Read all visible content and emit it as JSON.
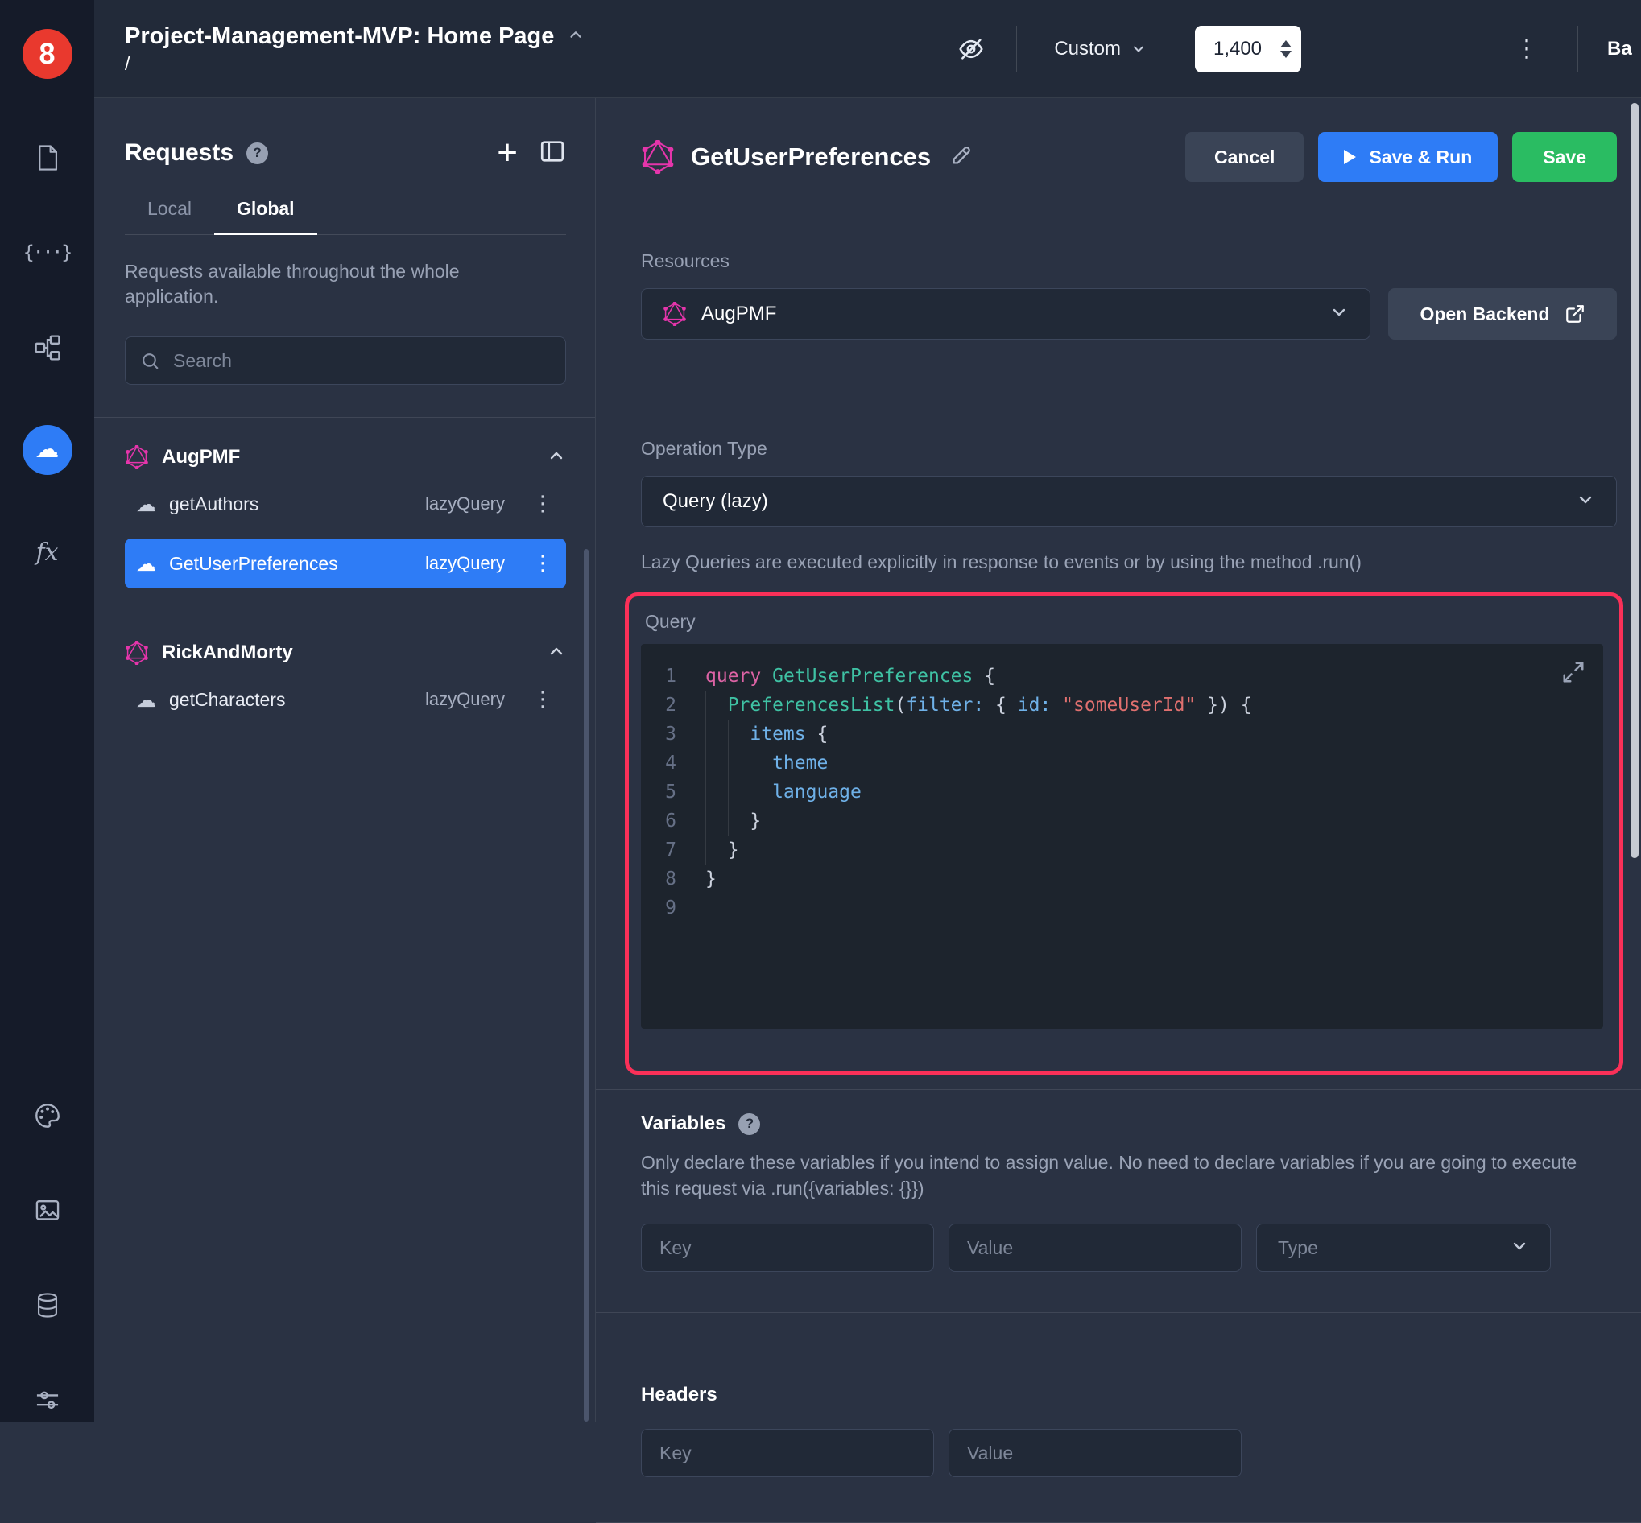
{
  "colors": {
    "accent_blue": "#2e7cf6",
    "save_green": "#2abc62",
    "annotation_pink": "#fa3058",
    "graphql_pink": "#e535ab"
  },
  "icons": {
    "cloud": "☁",
    "kebab": "⋮",
    "plus": "+",
    "help": "?",
    "braces": "{···}",
    "fx": "fx",
    "logo": "8"
  },
  "topbar": {
    "title": "Project-Management-MVP: Home Page",
    "path": "/",
    "breakpoint": "Custom",
    "canvas_width": "1,400",
    "clipped_right_text": "Ba"
  },
  "requests": {
    "title": "Requests",
    "tabs": {
      "local": "Local",
      "global": "Global"
    },
    "description": "Requests available throughout the whole application.",
    "search_placeholder": "Search",
    "groups": [
      {
        "name": "AugPMF",
        "items": [
          {
            "name": "getAuthors",
            "kind": "lazyQuery"
          },
          {
            "name": "GetUserPreferences",
            "kind": "lazyQuery"
          }
        ]
      },
      {
        "name": "RickAndMorty",
        "items": [
          {
            "name": "getCharacters",
            "kind": "lazyQuery"
          }
        ]
      }
    ]
  },
  "main": {
    "title": "GetUserPreferences",
    "buttons": {
      "cancel": "Cancel",
      "save_run": "Save & Run",
      "save": "Save"
    },
    "resources": {
      "label": "Resources",
      "value": "AugPMF",
      "open_backend": "Open Backend"
    },
    "operation": {
      "label": "Operation Type",
      "value": "Query (lazy)",
      "hint": "Lazy Queries are executed explicitly in response to events or by using the method .run()"
    },
    "query": {
      "label": "Query",
      "lines": [
        {
          "n": "1",
          "tokens": [
            [
              "kw",
              "query"
            ],
            [
              "p",
              " "
            ],
            [
              "ty",
              "GetUserPreferences"
            ],
            [
              "p",
              " {"
            ]
          ]
        },
        {
          "n": "2",
          "tokens": [
            [
              "ind",
              "  "
            ],
            [
              "ty",
              "PreferencesList"
            ],
            [
              "p",
              "("
            ],
            [
              "fld",
              "filter:"
            ],
            [
              "p",
              " { "
            ],
            [
              "fld",
              "id:"
            ],
            [
              "p",
              " "
            ],
            [
              "str",
              "\"someUserId\""
            ],
            [
              "p",
              " }) {"
            ]
          ]
        },
        {
          "n": "3",
          "tokens": [
            [
              "ind",
              "  "
            ],
            [
              "ind",
              "  "
            ],
            [
              "fld",
              "items"
            ],
            [
              "p",
              " {"
            ]
          ]
        },
        {
          "n": "4",
          "tokens": [
            [
              "ind",
              "  "
            ],
            [
              "ind",
              "  "
            ],
            [
              "ind",
              "  "
            ],
            [
              "fld",
              "theme"
            ]
          ]
        },
        {
          "n": "5",
          "tokens": [
            [
              "ind",
              "  "
            ],
            [
              "ind",
              "  "
            ],
            [
              "ind",
              "  "
            ],
            [
              "fld",
              "language"
            ]
          ]
        },
        {
          "n": "6",
          "tokens": [
            [
              "ind",
              "  "
            ],
            [
              "ind",
              "  "
            ],
            [
              "p",
              "}"
            ]
          ]
        },
        {
          "n": "7",
          "tokens": [
            [
              "ind",
              "  "
            ],
            [
              "p",
              "}"
            ]
          ]
        },
        {
          "n": "8",
          "tokens": [
            [
              "p",
              "}"
            ]
          ]
        },
        {
          "n": "9",
          "tokens": []
        }
      ]
    },
    "variables": {
      "title": "Variables",
      "description": "Only declare these variables if you intend to assign value. No need to declare variables if you are going to execute this request via .run({variables: {}})",
      "key_placeholder": "Key",
      "value_placeholder": "Value",
      "type_placeholder": "Type"
    },
    "headers": {
      "title": "Headers",
      "key_placeholder": "Key",
      "value_placeholder": "Value"
    }
  }
}
